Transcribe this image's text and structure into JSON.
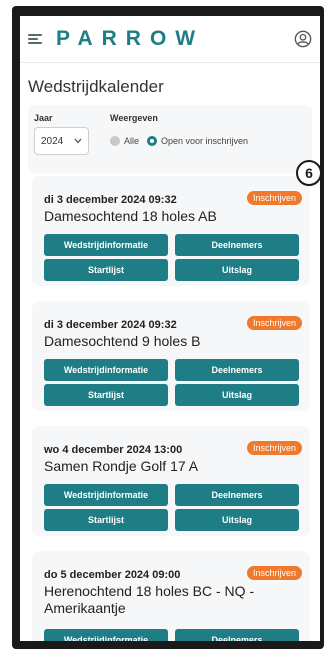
{
  "app": {
    "logo": "PARROW"
  },
  "page": {
    "title": "Wedstrijdkalender"
  },
  "filters": {
    "year_label": "Jaar",
    "year_value": "2024",
    "show_label": "Weergeven",
    "options": [
      {
        "label": "Alle",
        "selected": false
      },
      {
        "label": "Open voor inschrijven",
        "selected": true
      }
    ]
  },
  "marker": "6",
  "cards": [
    {
      "date": "di 3 december 2024 09:32",
      "title": "Damesochtend 18 holes AB",
      "badge": "Inschrijven",
      "buttons": [
        "Wedstrijdinformatie",
        "Deelnemers",
        "Startlijst",
        "Uitslag"
      ]
    },
    {
      "date": "di 3 december 2024 09:32",
      "title": "Damesochtend 9 holes B",
      "badge": "Inschrijven",
      "buttons": [
        "Wedstrijdinformatie",
        "Deelnemers",
        "Startlijst",
        "Uitslag"
      ]
    },
    {
      "date": "wo 4 december 2024 13:00",
      "title": "Samen Rondje Golf 17 A",
      "badge": "Inschrijven",
      "buttons": [
        "Wedstrijdinformatie",
        "Deelnemers",
        "Startlijst",
        "Uitslag"
      ]
    },
    {
      "date": "do 5 december 2024 09:00",
      "title": "Herenochtend 18 holes BC - NQ - Amerikaantje",
      "badge": "Inschrijven",
      "buttons": [
        "Wedstrijdinformatie",
        "Deelnemers"
      ]
    }
  ],
  "colors": {
    "primary": "#1f7d85",
    "badge": "#ef7a2e",
    "card_bg": "#f6f7f8"
  }
}
